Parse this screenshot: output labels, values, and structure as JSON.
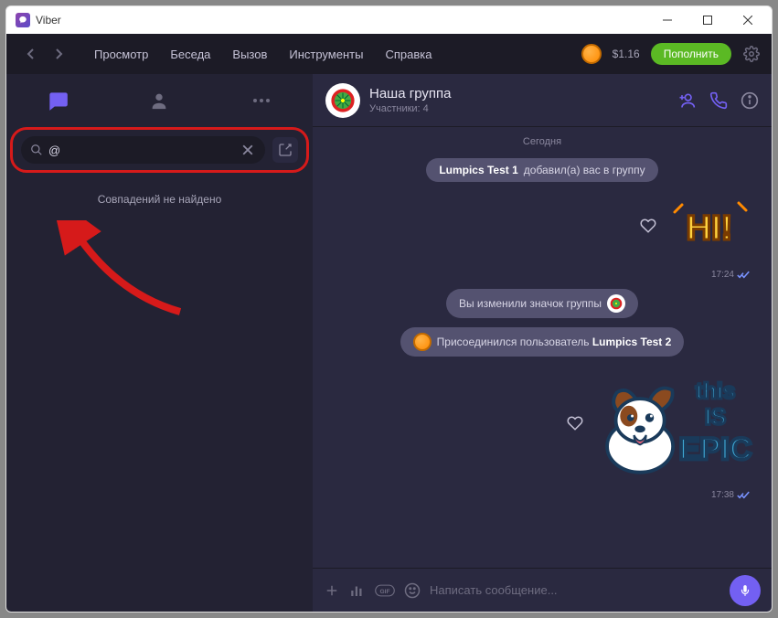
{
  "window": {
    "title": "Viber"
  },
  "menubar": {
    "items": [
      "Просмотр",
      "Беседа",
      "Вызов",
      "Инструменты",
      "Справка"
    ],
    "balance": "$1.16",
    "fund_button": "Пополнить"
  },
  "sidebar": {
    "search_value": "@",
    "no_results": "Совпадений не найдено"
  },
  "chat": {
    "title": "Наша группа",
    "subtitle": "Участники: 4",
    "day": "Сегодня",
    "sys1_prefix": "Lumpics Test 1",
    "sys1_rest": " добавил(а) вас в группу",
    "sys2": "Вы изменили значок группы",
    "sys3_prefix": "Присоединился пользователь ",
    "sys3_user": "Lumpics Test 2",
    "time1": "17:24",
    "time2": "17:38",
    "sticker2_l1": "this",
    "sticker2_l2": "IS",
    "sticker2_l3": "EPIC",
    "composer_placeholder": "Написать сообщение..."
  }
}
